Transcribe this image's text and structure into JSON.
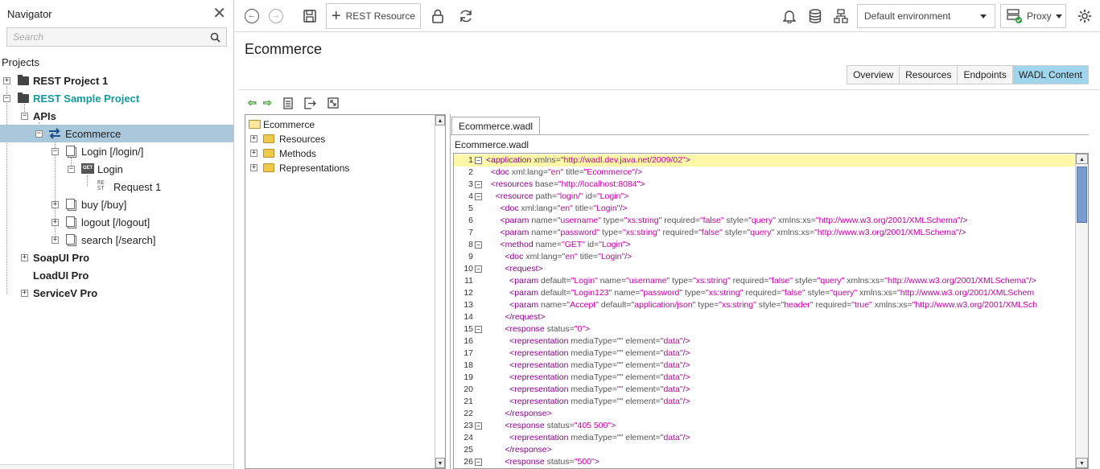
{
  "navigator": {
    "title": "Navigator",
    "search_placeholder": "Search",
    "projects_label": "Projects",
    "tree": {
      "rest_project_1": "REST Project 1",
      "rest_sample_project": "REST Sample Project",
      "apis": "APIs",
      "ecommerce": "Ecommerce",
      "login_resource": "Login [/login/]",
      "login_method": "Login",
      "get_badge": "GET",
      "request_1": "Request 1",
      "buy": "buy [/buy]",
      "logout": "logout [/logout]",
      "search": "search [/search]",
      "soapui_pro": "SoapUI Pro",
      "loadui_pro": "LoadUI Pro",
      "servicev_pro": "ServiceV Pro"
    }
  },
  "toolbar": {
    "rest_resource_label": "REST Resource",
    "environment": "Default environment",
    "proxy_label": "Proxy",
    "icons": [
      "back-icon",
      "forward-icon",
      "save-icon",
      "plus-icon",
      "lock-icon",
      "refresh-icon",
      "bell-icon",
      "database-icon",
      "network-icon",
      "proxy-icon",
      "gear-icon"
    ]
  },
  "main": {
    "title": "Ecommerce",
    "tabs": [
      "Overview",
      "Resources",
      "Endpoints",
      "WADL Content"
    ],
    "active_tab": "WADL Content",
    "wadl_tree": {
      "root": "Ecommerce",
      "items": [
        "Resources",
        "Methods",
        "Representations"
      ]
    },
    "file_tab": "Ecommerce.wadl",
    "file_label": "Ecommerce.wadl"
  },
  "code_lines": [
    {
      "n": "1",
      "fold": "−",
      "hl": true,
      "parts": [
        [
          "t",
          "<application "
        ],
        [
          "a",
          "xmlns="
        ],
        [
          "v",
          "\"http://wadl.dev.java.net/2009/02\""
        ],
        [
          "t",
          ">"
        ]
      ]
    },
    {
      "n": "2",
      "fold": "",
      "parts": [
        [
          "t",
          "  <doc "
        ],
        [
          "a",
          "xml:lang="
        ],
        [
          "v",
          "\"en\""
        ],
        [
          "a",
          " title="
        ],
        [
          "v",
          "\"Ecommerce\""
        ],
        [
          "t",
          "/>"
        ]
      ]
    },
    {
      "n": "3",
      "fold": "−",
      "parts": [
        [
          "t",
          "  <resources "
        ],
        [
          "a",
          "base="
        ],
        [
          "v",
          "\"http://localhost:8084\""
        ],
        [
          "t",
          ">"
        ]
      ]
    },
    {
      "n": "4",
      "fold": "−",
      "parts": [
        [
          "t",
          "    <resource "
        ],
        [
          "a",
          "path="
        ],
        [
          "v",
          "\"login/\""
        ],
        [
          "a",
          " id="
        ],
        [
          "v",
          "\"Login\""
        ],
        [
          "t",
          ">"
        ]
      ]
    },
    {
      "n": "5",
      "fold": "",
      "parts": [
        [
          "t",
          "      <doc "
        ],
        [
          "a",
          "xml:lang="
        ],
        [
          "v",
          "\"en\""
        ],
        [
          "a",
          " title="
        ],
        [
          "v",
          "\"Login\""
        ],
        [
          "t",
          "/>"
        ]
      ]
    },
    {
      "n": "6",
      "fold": "",
      "parts": [
        [
          "t",
          "      <param "
        ],
        [
          "a",
          "name="
        ],
        [
          "v",
          "\"username\""
        ],
        [
          "a",
          " type="
        ],
        [
          "v",
          "\"xs:string\""
        ],
        [
          "a",
          " required="
        ],
        [
          "v",
          "\"false\""
        ],
        [
          "a",
          " style="
        ],
        [
          "v",
          "\"query\""
        ],
        [
          "a",
          " xmlns:xs="
        ],
        [
          "v",
          "\"http://www.w3.org/2001/XMLSchema\""
        ],
        [
          "t",
          "/>"
        ]
      ]
    },
    {
      "n": "7",
      "fold": "",
      "parts": [
        [
          "t",
          "      <param "
        ],
        [
          "a",
          "name="
        ],
        [
          "v",
          "\"password\""
        ],
        [
          "a",
          " type="
        ],
        [
          "v",
          "\"xs:string\""
        ],
        [
          "a",
          " required="
        ],
        [
          "v",
          "\"false\""
        ],
        [
          "a",
          " style="
        ],
        [
          "v",
          "\"query\""
        ],
        [
          "a",
          " xmlns:xs="
        ],
        [
          "v",
          "\"http://www.w3.org/2001/XMLSchema\""
        ],
        [
          "t",
          "/>"
        ]
      ]
    },
    {
      "n": "8",
      "fold": "−",
      "parts": [
        [
          "t",
          "      <method "
        ],
        [
          "a",
          "name="
        ],
        [
          "v",
          "\"GET\""
        ],
        [
          "a",
          " id="
        ],
        [
          "v",
          "\"Login\""
        ],
        [
          "t",
          ">"
        ]
      ]
    },
    {
      "n": "9",
      "fold": "",
      "parts": [
        [
          "t",
          "        <doc "
        ],
        [
          "a",
          "xml:lang="
        ],
        [
          "v",
          "\"en\""
        ],
        [
          "a",
          " title="
        ],
        [
          "v",
          "\"Login\""
        ],
        [
          "t",
          "/>"
        ]
      ]
    },
    {
      "n": "10",
      "fold": "−",
      "parts": [
        [
          "t",
          "        <request>"
        ]
      ]
    },
    {
      "n": "11",
      "fold": "",
      "parts": [
        [
          "t",
          "          <param "
        ],
        [
          "a",
          "default="
        ],
        [
          "v",
          "\"Login\""
        ],
        [
          "a",
          " name="
        ],
        [
          "v",
          "\"username\""
        ],
        [
          "a",
          " type="
        ],
        [
          "v",
          "\"xs:string\""
        ],
        [
          "a",
          " required="
        ],
        [
          "v",
          "\"false\""
        ],
        [
          "a",
          " style="
        ],
        [
          "v",
          "\"query\""
        ],
        [
          "a",
          " xmlns:xs="
        ],
        [
          "v",
          "\"http://www.w3.org/2001/XMLSchema\""
        ],
        [
          "t",
          "/>"
        ]
      ]
    },
    {
      "n": "12",
      "fold": "",
      "parts": [
        [
          "t",
          "          <param "
        ],
        [
          "a",
          "default="
        ],
        [
          "v",
          "\"Login123\""
        ],
        [
          "a",
          " name="
        ],
        [
          "v",
          "\"password\""
        ],
        [
          "a",
          " type="
        ],
        [
          "v",
          "\"xs:string\""
        ],
        [
          "a",
          " required="
        ],
        [
          "v",
          "\"false\""
        ],
        [
          "a",
          " style="
        ],
        [
          "v",
          "\"query\""
        ],
        [
          "a",
          " xmlns:xs="
        ],
        [
          "v",
          "\"http://www.w3.org/2001/XMLSchem"
        ]
      ]
    },
    {
      "n": "13",
      "fold": "",
      "parts": [
        [
          "t",
          "          <param "
        ],
        [
          "a",
          "name="
        ],
        [
          "v",
          "\"Accept\""
        ],
        [
          "a",
          " default="
        ],
        [
          "v",
          "\"application/json\""
        ],
        [
          "a",
          " type="
        ],
        [
          "v",
          "\"xs:string\""
        ],
        [
          "a",
          " style="
        ],
        [
          "v",
          "\"header\""
        ],
        [
          "a",
          " required="
        ],
        [
          "v",
          "\"true\""
        ],
        [
          "a",
          " xmlns:xs="
        ],
        [
          "v",
          "\"http://www.w3.org/2001/XMLSch"
        ]
      ]
    },
    {
      "n": "14",
      "fold": "",
      "parts": [
        [
          "t",
          "        </request>"
        ]
      ]
    },
    {
      "n": "15",
      "fold": "−",
      "parts": [
        [
          "t",
          "        <response "
        ],
        [
          "a",
          "status="
        ],
        [
          "v",
          "\"0\""
        ],
        [
          "t",
          ">"
        ]
      ]
    },
    {
      "n": "16",
      "fold": "",
      "parts": [
        [
          "t",
          "          <representation "
        ],
        [
          "a",
          "mediaType="
        ],
        [
          "v",
          "\"\""
        ],
        [
          "a",
          " element="
        ],
        [
          "v",
          "\"data\""
        ],
        [
          "t",
          "/>"
        ]
      ]
    },
    {
      "n": "17",
      "fold": "",
      "parts": [
        [
          "t",
          "          <representation "
        ],
        [
          "a",
          "mediaType="
        ],
        [
          "v",
          "\"\""
        ],
        [
          "a",
          " element="
        ],
        [
          "v",
          "\"data\""
        ],
        [
          "t",
          "/>"
        ]
      ]
    },
    {
      "n": "18",
      "fold": "",
      "parts": [
        [
          "t",
          "          <representation "
        ],
        [
          "a",
          "mediaType="
        ],
        [
          "v",
          "\"\""
        ],
        [
          "a",
          " element="
        ],
        [
          "v",
          "\"data\""
        ],
        [
          "t",
          "/>"
        ]
      ]
    },
    {
      "n": "19",
      "fold": "",
      "parts": [
        [
          "t",
          "          <representation "
        ],
        [
          "a",
          "mediaType="
        ],
        [
          "v",
          "\"\""
        ],
        [
          "a",
          " element="
        ],
        [
          "v",
          "\"data\""
        ],
        [
          "t",
          "/>"
        ]
      ]
    },
    {
      "n": "20",
      "fold": "",
      "parts": [
        [
          "t",
          "          <representation "
        ],
        [
          "a",
          "mediaType="
        ],
        [
          "v",
          "\"\""
        ],
        [
          "a",
          " element="
        ],
        [
          "v",
          "\"data\""
        ],
        [
          "t",
          "/>"
        ]
      ]
    },
    {
      "n": "21",
      "fold": "",
      "parts": [
        [
          "t",
          "          <representation "
        ],
        [
          "a",
          "mediaType="
        ],
        [
          "v",
          "\"\""
        ],
        [
          "a",
          " element="
        ],
        [
          "v",
          "\"data\""
        ],
        [
          "t",
          "/>"
        ]
      ]
    },
    {
      "n": "22",
      "fold": "",
      "parts": [
        [
          "t",
          "        </response>"
        ]
      ]
    },
    {
      "n": "23",
      "fold": "−",
      "parts": [
        [
          "t",
          "        <response "
        ],
        [
          "a",
          "status="
        ],
        [
          "v",
          "\"405 500\""
        ],
        [
          "t",
          ">"
        ]
      ]
    },
    {
      "n": "24",
      "fold": "",
      "parts": [
        [
          "t",
          "          <representation "
        ],
        [
          "a",
          "mediaType="
        ],
        [
          "v",
          "\"\""
        ],
        [
          "a",
          " element="
        ],
        [
          "v",
          "\"data\""
        ],
        [
          "t",
          "/>"
        ]
      ]
    },
    {
      "n": "25",
      "fold": "",
      "parts": [
        [
          "t",
          "        </response>"
        ]
      ]
    },
    {
      "n": "26",
      "fold": "−",
      "parts": [
        [
          "t",
          "        <response "
        ],
        [
          "a",
          "status="
        ],
        [
          "v",
          "\"500\""
        ],
        [
          "t",
          ">"
        ]
      ]
    }
  ],
  "colors": {
    "accent_teal": "#14999a",
    "selected_row": "#a9c8db",
    "active_tab": "#9fd6ee",
    "highlight_line": "#fff8a8"
  }
}
